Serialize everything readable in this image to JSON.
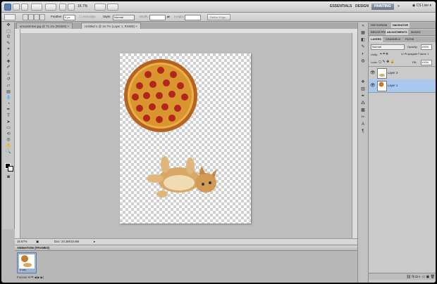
{
  "app": {
    "zoom_display": "16.7%",
    "workspaces": [
      "ESSENTIALS",
      "DESIGN",
      "PAINTING"
    ],
    "active_workspace": "PAINTING",
    "cs_live": "CS Live"
  },
  "options_bar": {
    "feather_label": "Feather:",
    "feather_value": "0 px",
    "antialias_label": "Anti-alias",
    "style_label": "Style:",
    "style_value": "Normal",
    "width_label": "Width:",
    "height_label": "Height:",
    "refine_edge_label": "Refine Edge..."
  },
  "tabs": [
    {
      "label": "armanitinker.jpg @ 71.1% (RGB/8)"
    },
    {
      "label": "Untitled-1 @ 16.7% (Layer 1, RGB/8)"
    }
  ],
  "status": {
    "zoom": "16.67%",
    "doc": "Doc: 24.3M/15.6M"
  },
  "animation": {
    "title": "ANIMATION (FRAMES)",
    "frame_delay": "0 sec.",
    "loop": "Forever"
  },
  "panels": {
    "top_tabs": [
      "HISTOGRAM",
      "NAVIGATOR"
    ],
    "mid_tabs": [
      "BRUSH PRESETS",
      "ADJUSTMENTS",
      "MASKS"
    ],
    "layer_tabs": [
      "LAYERS",
      "CHANNELS",
      "PATHS"
    ],
    "blend_mode": "Normal",
    "opacity_label": "Opacity:",
    "opacity_value": "100%",
    "unify_label": "Unify:",
    "propagate_label": "Propagate Frame 1",
    "lock_label": "Lock:",
    "fill_label": "Fill:",
    "fill_value": "100%",
    "layers": [
      {
        "name": "Layer 2",
        "selected": false
      },
      {
        "name": "Layer 1",
        "selected": true
      }
    ]
  }
}
